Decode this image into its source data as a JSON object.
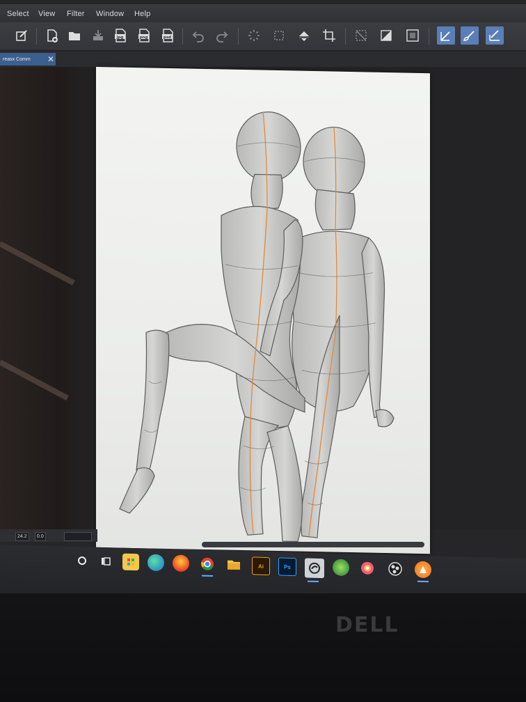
{
  "menu": {
    "select": "Select",
    "view": "View",
    "filter": "Filter",
    "window": "Window",
    "help": "Help"
  },
  "tab": {
    "title": "reasx Comm",
    "close": "✕"
  },
  "toolbar": {
    "export_jpg": "jpg",
    "export_png": "png",
    "export_psd": "psd",
    "accent": "#5a7fb8"
  },
  "status": {
    "field1": "24.2",
    "field2": "0.0"
  },
  "taskbar": {
    "illustrator": "Ai",
    "photoshop": "Ps"
  },
  "monitor": {
    "brand": "DELL"
  },
  "colors": {
    "canvas": "#f1f2f0",
    "mannequin": "#c9c9c7",
    "mannequin_outline": "#5b5b5b",
    "center_line": "#e08a3c",
    "tab_active": "#3d5f8f"
  }
}
